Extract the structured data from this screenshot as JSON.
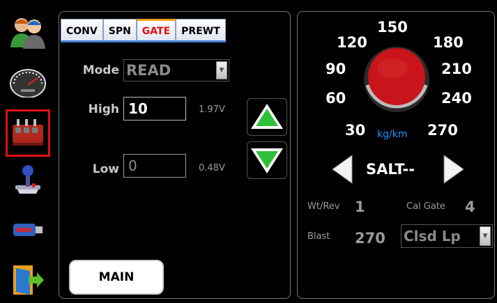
{
  "sidebar": {
    "items": [
      {
        "name": "users",
        "icon": "users-icon",
        "selected": false
      },
      {
        "name": "speedometer",
        "icon": "speedometer-icon",
        "selected": false
      },
      {
        "name": "spreader-valve",
        "icon": "valve-icon",
        "selected": true
      },
      {
        "name": "joystick",
        "icon": "joystick-icon",
        "selected": false
      },
      {
        "name": "usb-drive",
        "icon": "usb-drive-icon",
        "selected": false
      },
      {
        "name": "exit",
        "icon": "exit-door-icon",
        "selected": false
      }
    ]
  },
  "tabs": [
    {
      "label": "CONV",
      "active": false
    },
    {
      "label": "SPN",
      "active": false
    },
    {
      "label": "GATE",
      "active": true
    },
    {
      "label": "PREWT",
      "active": false
    }
  ],
  "gate": {
    "mode_label": "Mode",
    "mode_value": "READ",
    "high_label": "High",
    "high_value": "10",
    "high_voltage": "1.97V",
    "low_label": "Low",
    "low_value": "0",
    "low_voltage": "0.48V",
    "main_button": "MAIN"
  },
  "dial": {
    "ticks": [
      "30",
      "60",
      "90",
      "120",
      "150",
      "180",
      "210",
      "240",
      "270"
    ],
    "unit": "kg/km",
    "knob_color": "#c8141a"
  },
  "material": {
    "name": "SALT--"
  },
  "stats": {
    "wtrev_label": "Wt/Rev",
    "wtrev_value": "1",
    "calgate_label": "Cal Gate",
    "calgate_value": "4",
    "blast_label": "Blast",
    "blast_value": "270",
    "loop_value": "Clsd Lp"
  },
  "colors": {
    "accent_green": "#2fbf3a",
    "active_tab": "#e01010",
    "unit_blue": "#1e90ff"
  }
}
